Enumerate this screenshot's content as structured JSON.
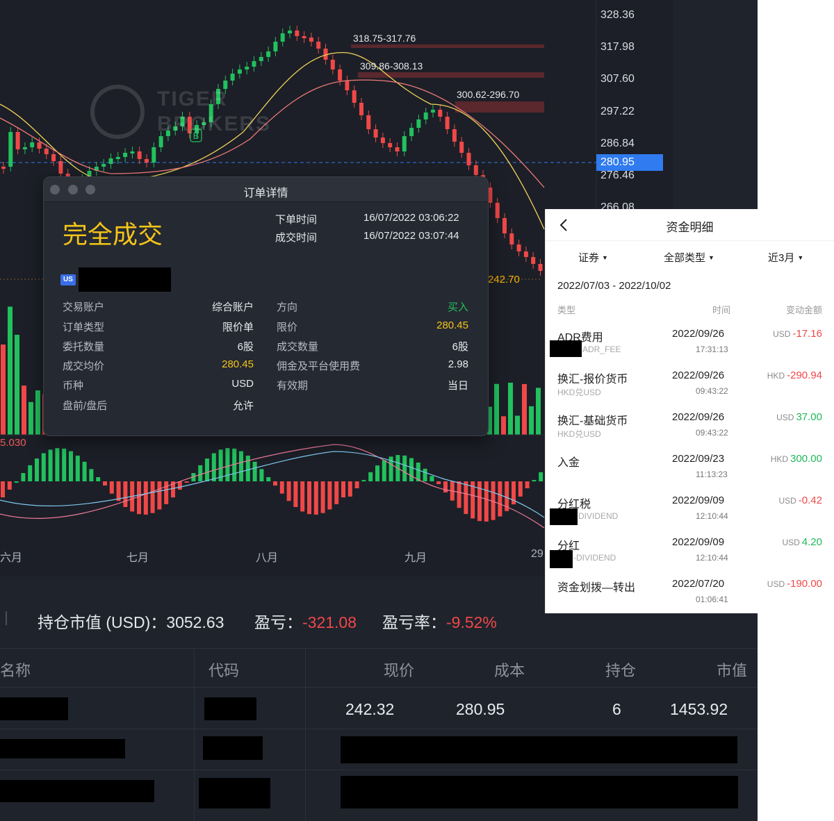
{
  "chart": {
    "price_axis": [
      "328.36",
      "317.98",
      "307.60",
      "297.22",
      "286.84",
      "276.46",
      "266.08"
    ],
    "current_price": "280.95",
    "low_price_label": "242.70",
    "level_labels": [
      "318.75-317.76",
      "309.86-308.13",
      "300.62-296.70"
    ],
    "macd_label": "5.030",
    "buy_marker": "B",
    "months": [
      "六月",
      "七月",
      "八月",
      "九月",
      "29"
    ],
    "watermark": "TIGER BROKERS",
    "colors": {
      "up": "#22c15e",
      "down": "#f04848",
      "ma_short": "#f0d35a",
      "ma_long": "#f07a7a"
    }
  },
  "summary": {
    "market_value_label": "持仓市值 (USD)：",
    "market_value": "3052.63",
    "pnl_label": "盈亏：",
    "pnl": "-321.08",
    "pnl_rate_label": "盈亏率：",
    "pnl_rate": "-9.52%"
  },
  "holdings": {
    "headers": [
      "名称",
      "代码",
      "现价",
      "成本",
      "持仓",
      "市值"
    ],
    "row1": {
      "price": "242.32",
      "cost": "280.95",
      "qty": "6",
      "value": "1453.92"
    }
  },
  "order": {
    "window_title": "订单详情",
    "status": "完全成交",
    "place_time_label": "下单时间",
    "place_time": "16/07/2022 03:06:22",
    "fill_time_label": "成交时间",
    "fill_time": "16/07/2022 03:07:44",
    "market_badge": "US",
    "left_fields": [
      {
        "label": "交易账户",
        "value": "综合账户"
      },
      {
        "label": "订单类型",
        "value": "限价单"
      },
      {
        "label": "委托数量",
        "value": "6股"
      },
      {
        "label": "成交均价",
        "value": "280.45"
      },
      {
        "label": "币种",
        "value": "USD"
      },
      {
        "label": "盘前/盘后",
        "value": "允许"
      }
    ],
    "right_fields": [
      {
        "label": "方向",
        "value": "买入"
      },
      {
        "label": "限价",
        "value": "280.45"
      },
      {
        "label": "成交数量",
        "value": "6股"
      },
      {
        "label": "佣金及平台使用费",
        "value": "2.98"
      },
      {
        "label": "有效期",
        "value": "当日"
      }
    ]
  },
  "fund": {
    "title": "资金明细",
    "filters": [
      "证券",
      "全部类型",
      "近3月"
    ],
    "date_range": "2022/07/03 - 2022/10/02",
    "headers": {
      "type": "类型",
      "time": "时间",
      "amount": "变动金额"
    },
    "records": [
      {
        "name": "ADR费用",
        "sub": "ADR_FEE",
        "date": "2022/09/26",
        "time": "17:31:13",
        "currency": "USD",
        "amount": "-17.16"
      },
      {
        "name": "换汇-报价货币",
        "sub": "HKD兑USD",
        "date": "2022/09/26",
        "time": "09:43:22",
        "currency": "HKD",
        "amount": "-290.94"
      },
      {
        "name": "换汇-基础货币",
        "sub": "HKD兑USD",
        "date": "2022/09/26",
        "time": "09:43:22",
        "currency": "USD",
        "amount": "37.00"
      },
      {
        "name": "入金",
        "sub": "",
        "date": "2022/09/23",
        "time": "11:13:23",
        "currency": "HKD",
        "amount": "300.00"
      },
      {
        "name": "分红税",
        "sub": "DIVIDEND",
        "date": "2022/09/09",
        "time": "12:10:44",
        "currency": "USD",
        "amount": "-0.42"
      },
      {
        "name": "分红",
        "sub": "-DIVIDEND",
        "date": "2022/09/09",
        "time": "12:10:44",
        "currency": "USD",
        "amount": "4.20"
      },
      {
        "name": "资金划拨—转出",
        "sub": "",
        "date": "2022/07/20",
        "time": "01:06:41",
        "currency": "USD",
        "amount": "-190.00"
      }
    ]
  }
}
